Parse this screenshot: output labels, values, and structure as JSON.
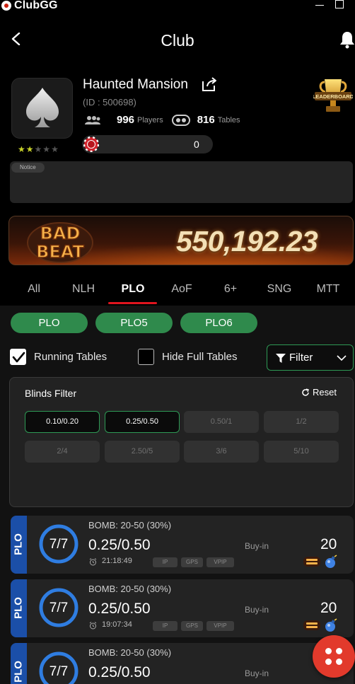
{
  "app": {
    "name": "ClubGG"
  },
  "header": {
    "title": "Club"
  },
  "club": {
    "name": "Haunted Mansion",
    "id_text": "(ID : 500698)",
    "players_count": "996",
    "players_label": "Players",
    "tables_count": "816",
    "tables_label": "Tables",
    "chips": "0",
    "stars_filled": 2,
    "stars_total": 5,
    "leaderboard_label": "LEADERBOARD"
  },
  "notice": {
    "tag": "Notice",
    "text": ""
  },
  "jackpot": {
    "logo_line1": "BAD",
    "logo_line2": "BEAT",
    "amount": "550,192.23"
  },
  "tabs": [
    {
      "label": "All",
      "active": false
    },
    {
      "label": "NLH",
      "active": false
    },
    {
      "label": "PLO",
      "active": true
    },
    {
      "label": "AoF",
      "active": false
    },
    {
      "label": "6+",
      "active": false
    },
    {
      "label": "SNG",
      "active": false
    },
    {
      "label": "MTT",
      "active": false
    }
  ],
  "game_types": [
    "PLO",
    "PLO5",
    "PLO6"
  ],
  "options": {
    "running_tables": {
      "label": "Running Tables",
      "checked": true
    },
    "hide_full": {
      "label": "Hide Full Tables",
      "checked": false
    },
    "filter_label": "Filter"
  },
  "blinds_filter": {
    "title": "Blinds Filter",
    "reset_label": "Reset",
    "options": [
      {
        "label": "0.10/0.20",
        "selected": true
      },
      {
        "label": "0.25/0.50",
        "selected": true
      },
      {
        "label": "0.50/1",
        "selected": false
      },
      {
        "label": "1/2",
        "selected": false
      },
      {
        "label": "2/4",
        "selected": false
      },
      {
        "label": "2.50/5",
        "selected": false
      },
      {
        "label": "3/6",
        "selected": false
      },
      {
        "label": "5/10",
        "selected": false
      }
    ]
  },
  "tables": [
    {
      "game": "PLO",
      "seats": "7/7",
      "fill": 1.0,
      "bomb": "BOMB: 20-50 (30%)",
      "stakes": "0.25/0.50",
      "time": "21:18:49",
      "buyin_label": "Buy-in",
      "buyin": "20",
      "features": [
        "IP",
        "GPS",
        "VPIP"
      ]
    },
    {
      "game": "PLO",
      "seats": "7/7",
      "fill": 1.0,
      "bomb": "BOMB: 20-50 (30%)",
      "stakes": "0.25/0.50",
      "time": "19:07:34",
      "buyin_label": "Buy-in",
      "buyin": "20",
      "features": [
        "IP",
        "GPS",
        "VPIP"
      ]
    },
    {
      "game": "PLO",
      "seats": "7/7",
      "fill": 1.0,
      "bomb": "BOMB: 20-50 (30%)",
      "stakes": "0.25/0.50",
      "time": "",
      "buyin_label": "Buy-in",
      "buyin": "",
      "features": []
    }
  ],
  "colors": {
    "accent_green": "#2f8a4c",
    "accent_red": "#e0141e",
    "table_blue": "#1b4fa8",
    "ring_blue": "#2f7de1"
  }
}
